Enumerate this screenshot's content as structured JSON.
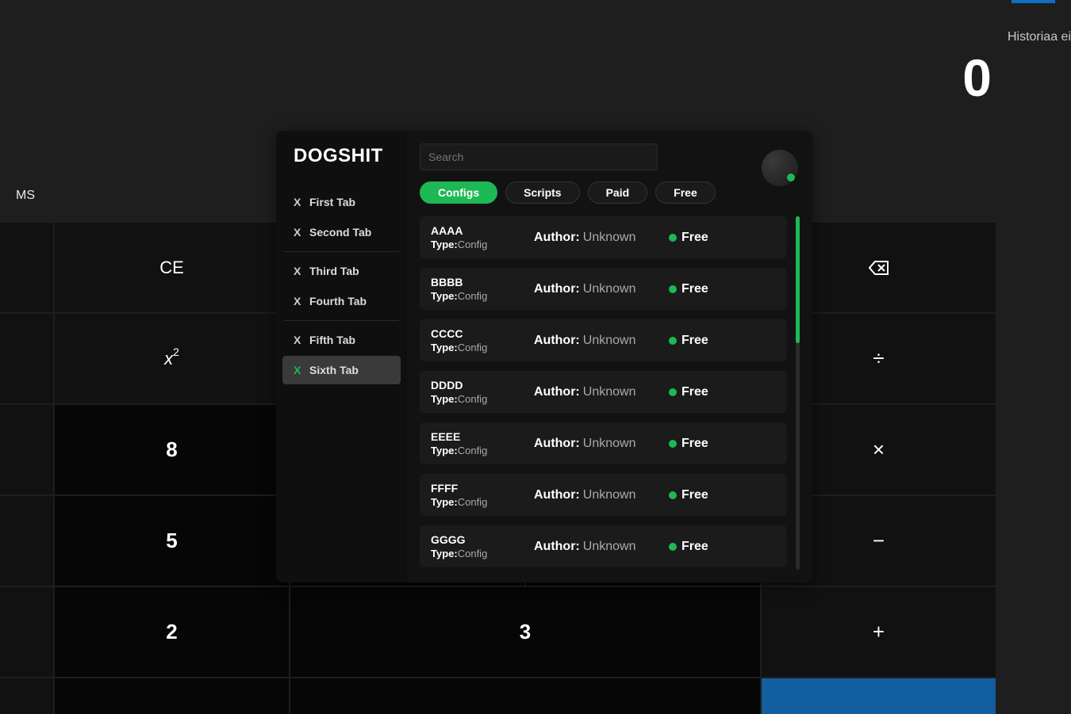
{
  "calculator": {
    "history_text": "Historiaa ei",
    "display": "0",
    "mem_button": "MS",
    "buttons": {
      "ce": "CE",
      "backspace": "⌫",
      "square": "x",
      "square_exp": "2",
      "divide": "÷",
      "multiply": "×",
      "minus": "−",
      "plus": "+",
      "n8": "8",
      "n5": "5",
      "n2": "2",
      "n3": "3"
    }
  },
  "panel": {
    "title": "DOGSHIT",
    "tabs": [
      {
        "label": "First Tab"
      },
      {
        "label": "Second Tab"
      },
      {
        "label": "Third Tab"
      },
      {
        "label": "Fourth Tab"
      },
      {
        "label": "Fifth Tab"
      },
      {
        "label": "Sixth Tab"
      }
    ],
    "search_placeholder": "Search",
    "filters": {
      "configs": "Configs",
      "scripts": "Scripts",
      "paid": "Paid",
      "free": "Free"
    },
    "labels": {
      "type": "Type:",
      "author": "Author:",
      "type_value": "Config",
      "author_value": "Unknown",
      "badge": "Free"
    },
    "items": [
      {
        "name": "AAAA"
      },
      {
        "name": "BBBB"
      },
      {
        "name": "CCCC"
      },
      {
        "name": "DDDD"
      },
      {
        "name": "EEEE"
      },
      {
        "name": "FFFF"
      },
      {
        "name": "GGGG"
      }
    ]
  }
}
